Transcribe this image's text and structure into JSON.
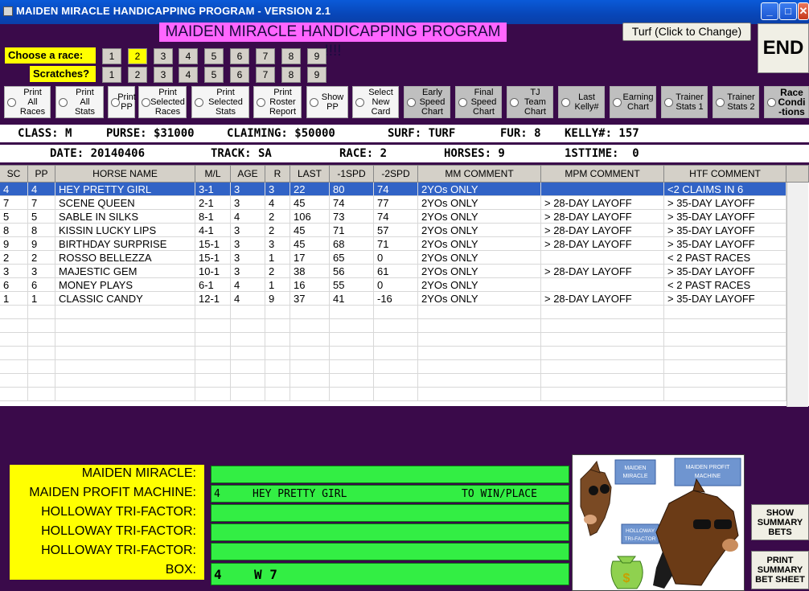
{
  "window": {
    "title": "MAIDEN MIRACLE HANDICAPPING PROGRAM - VERSION 2.1"
  },
  "banner": "MAIDEN MIRACLE HANDICAPPING PROGRAM !!!!",
  "turf_button": "Turf (Click to Change)",
  "end_button": "END",
  "choose_race": {
    "label": "Choose  a race:",
    "options": [
      "1",
      "2",
      "3",
      "4",
      "5",
      "6",
      "7",
      "8",
      "9"
    ],
    "selected": "2"
  },
  "scratches": {
    "label": "Scratches?",
    "options": [
      "1",
      "2",
      "3",
      "4",
      "5",
      "6",
      "7",
      "8",
      "9"
    ]
  },
  "options": [
    "Print\nAll\nRaces",
    "Print\nAll\nStats",
    "Print\nPP",
    "Print\nSelected\nRaces",
    "Print\nSelected\nStats",
    "Print\nRoster\nReport",
    "Show\nPP",
    "Select\nNew\nCard",
    "Early\nSpeed\nChart",
    "Final\nSpeed\nChart",
    "TJ\nTeam\nChart",
    "Last\nKelly#",
    "Earning\nChart",
    "Trainer\nStats 1",
    "Trainer\nStats 2",
    "Race\nCondi\n-tions"
  ],
  "info1": {
    "class": "CLASS: M",
    "purse": "PURSE: $31000",
    "claiming": "CLAIMING: $50000",
    "surf": "SURF: TURF",
    "fur": "FUR: 8",
    "kelly": "KELLY#: 157"
  },
  "info2": {
    "date": "DATE: 20140406",
    "track": "TRACK: SA",
    "race": "RACE: 2",
    "horses": "HORSES: 9",
    "firsttime": "1STTIME:  0"
  },
  "table": {
    "headers": [
      "SC",
      "PP",
      "HORSE NAME",
      "M/L",
      "AGE",
      "R",
      "LAST",
      "-1SPD",
      "-2SPD",
      "MM COMMENT",
      "MPM COMMENT",
      "HTF COMMENT"
    ],
    "rows": [
      [
        "4",
        "4",
        "HEY PRETTY GIRL",
        "3-1",
        "3",
        "3",
        "22",
        "80",
        "74",
        "2YOs ONLY",
        "",
        "<2 CLAIMS IN 6"
      ],
      [
        "7",
        "7",
        "SCENE QUEEN",
        "2-1",
        "3",
        "4",
        "45",
        "74",
        "77",
        "2YOs ONLY",
        "> 28-DAY LAYOFF",
        "> 35-DAY LAYOFF"
      ],
      [
        "5",
        "5",
        "SABLE IN SILKS",
        "8-1",
        "4",
        "2",
        "106",
        "73",
        "74",
        "2YOs ONLY",
        "> 28-DAY LAYOFF",
        "> 35-DAY LAYOFF"
      ],
      [
        "8",
        "8",
        "KISSIN LUCKY LIPS",
        "4-1",
        "3",
        "2",
        "45",
        "71",
        "57",
        "2YOs ONLY",
        "> 28-DAY LAYOFF",
        "> 35-DAY LAYOFF"
      ],
      [
        "9",
        "9",
        "BIRTHDAY SURPRISE",
        "15-1",
        "3",
        "3",
        "45",
        "68",
        "71",
        "2YOs ONLY",
        "> 28-DAY LAYOFF",
        "> 35-DAY LAYOFF"
      ],
      [
        "2",
        "2",
        "ROSSO BELLEZZA",
        "15-1",
        "3",
        "1",
        "17",
        "65",
        "0",
        "2YOs ONLY",
        "",
        "< 2 PAST RACES"
      ],
      [
        "3",
        "3",
        "MAJESTIC GEM",
        "10-1",
        "3",
        "2",
        "38",
        "56",
        "61",
        "2YOs ONLY",
        "> 28-DAY LAYOFF",
        "> 35-DAY LAYOFF"
      ],
      [
        "6",
        "6",
        "MONEY PLAYS",
        "6-1",
        "4",
        "1",
        "16",
        "55",
        "0",
        "2YOs ONLY",
        "",
        "< 2 PAST RACES"
      ],
      [
        "1",
        "1",
        "CLASSIC CANDY",
        "12-1",
        "4",
        "9",
        "37",
        "41",
        "-16",
        "2YOs ONLY",
        "> 28-DAY LAYOFF",
        "> 35-DAY LAYOFF"
      ]
    ]
  },
  "bottom": {
    "labels": [
      "MAIDEN MIRACLE:",
      "MAIDEN PROFIT MACHINE:",
      "HOLLOWAY TRI-FACTOR:",
      "HOLLOWAY TRI-FACTOR:",
      "HOLLOWAY TRI-FACTOR:",
      "BOX:"
    ],
    "mpm_pp": "4",
    "mpm_horse": "HEY PRETTY GIRL",
    "mpm_bet": "TO WIN/PLACE",
    "box_a": "4",
    "box_b": "W 7"
  },
  "picture": {
    "label1": "MAIDEN\nMIRACLE",
    "label2": "MAIDEN PROFIT\nMACHINE",
    "label3": "HOLLOWAY\nTRI-FACTOR",
    "money": "$"
  },
  "show_summary": "SHOW\nSUMMARY\nBETS",
  "print_summary": "PRINT\nSUMMARY\nBET SHEET"
}
